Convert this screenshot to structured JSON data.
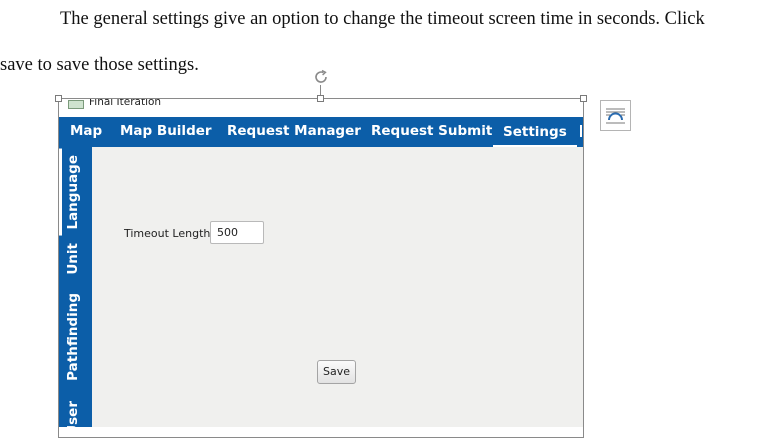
{
  "document": {
    "line1": "The general settings give an option to change the timeout screen time in seconds. Click",
    "line2": "save to save those settings."
  },
  "app": {
    "window_title": "Final Iteration",
    "nav_tabs": [
      {
        "label": "Map"
      },
      {
        "label": "Map Builder"
      },
      {
        "label": "Request Manager"
      },
      {
        "label": "Request Submit"
      },
      {
        "label": "Settings",
        "active": true
      }
    ],
    "side_tabs": [
      {
        "label": "Language",
        "active": true
      },
      {
        "label": "Unit"
      },
      {
        "label": "Pathfinding"
      },
      {
        "label": "User"
      }
    ],
    "timeout": {
      "label": "Timeout Length",
      "value": "500"
    },
    "save_label": "Save"
  },
  "colors": {
    "nav_bar": "#0c5ea8",
    "content_bg": "#f0f0ee",
    "text": "#111111"
  },
  "icons": [
    "rotate-handle-icon",
    "layout-options-icon",
    "window-app-icon"
  ]
}
